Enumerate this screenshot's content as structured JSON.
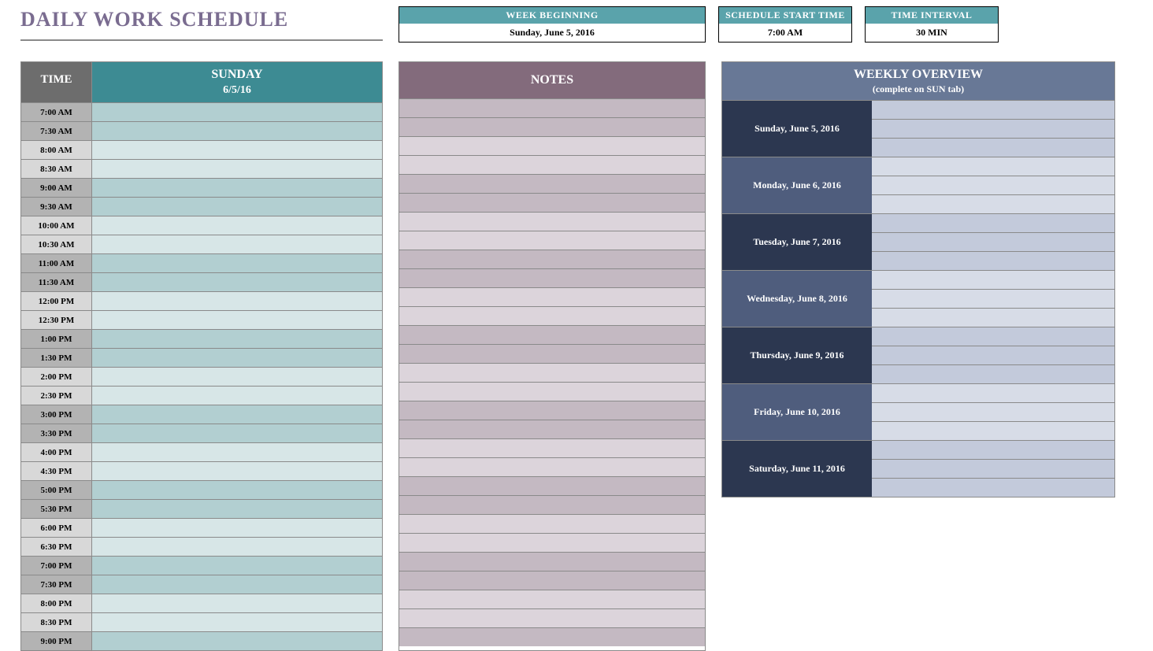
{
  "title": "DAILY WORK SCHEDULE",
  "info": {
    "week_beginning_label": "WEEK BEGINNING",
    "week_beginning_value": "Sunday, June 5, 2016",
    "start_time_label": "SCHEDULE START TIME",
    "start_time_value": "7:00 AM",
    "interval_label": "TIME INTERVAL",
    "interval_value": "30 MIN"
  },
  "schedule": {
    "time_header": "TIME",
    "day_header": "SUNDAY",
    "day_sub": "6/5/16",
    "times": [
      "7:00 AM",
      "7:30 AM",
      "8:00 AM",
      "8:30 AM",
      "9:00 AM",
      "9:30 AM",
      "10:00 AM",
      "10:30 AM",
      "11:00 AM",
      "11:30 AM",
      "12:00 PM",
      "12:30 PM",
      "1:00 PM",
      "1:30 PM",
      "2:00 PM",
      "2:30 PM",
      "3:00 PM",
      "3:30 PM",
      "4:00 PM",
      "4:30 PM",
      "5:00 PM",
      "5:30 PM",
      "6:00 PM",
      "6:30 PM",
      "7:00 PM",
      "7:30 PM",
      "8:00 PM",
      "8:30 PM",
      "9:00 PM"
    ],
    "entries": [
      "",
      "",
      "",
      "",
      "",
      "",
      "",
      "",
      "",
      "",
      "",
      "",
      "",
      "",
      "",
      "",
      "",
      "",
      "",
      "",
      "",
      "",
      "",
      "",
      "",
      "",
      "",
      "",
      ""
    ]
  },
  "notes": {
    "header": "NOTES",
    "rows": [
      "",
      "",
      "",
      "",
      "",
      "",
      "",
      "",
      "",
      "",
      "",
      "",
      "",
      "",
      "",
      "",
      "",
      "",
      "",
      "",
      "",
      "",
      "",
      "",
      "",
      "",
      "",
      "",
      ""
    ]
  },
  "weekly": {
    "header": "WEEKLY OVERVIEW",
    "sub": "(complete on SUN tab)",
    "days": [
      "Sunday, June 5, 2016",
      "Monday, June 6, 2016",
      "Tuesday, June 7, 2016",
      "Wednesday, June 8, 2016",
      "Thursday, June 9, 2016",
      "Friday, June 10, 2016",
      "Saturday, June 11, 2016"
    ],
    "cells": [
      "",
      "",
      "",
      "",
      "",
      "",
      "",
      "",
      "",
      "",
      "",
      "",
      "",
      "",
      "",
      "",
      "",
      "",
      "",
      "",
      ""
    ]
  }
}
